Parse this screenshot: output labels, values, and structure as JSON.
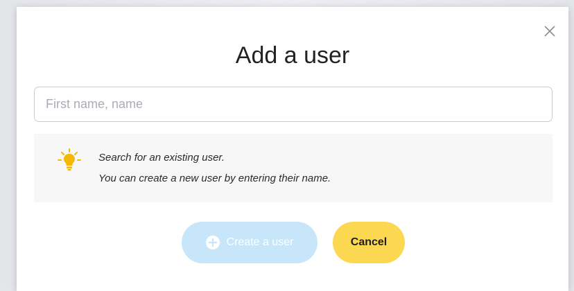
{
  "dialog": {
    "title": "Add a user",
    "close_icon": "close-icon"
  },
  "search": {
    "placeholder": "First name, name",
    "value": ""
  },
  "hint": {
    "icon": "lightbulb-icon",
    "line1": "Search for an existing user.",
    "line2": "You can create a new user by entering their name."
  },
  "actions": {
    "create_label": "Create a user",
    "create_icon": "plus-circle-icon",
    "create_disabled": true,
    "cancel_label": "Cancel"
  },
  "colors": {
    "create_button_bg": "#c8e6fa",
    "cancel_button_bg": "#fcd752",
    "hint_bg": "#f7f7f8",
    "bulb": "#f5b800"
  }
}
